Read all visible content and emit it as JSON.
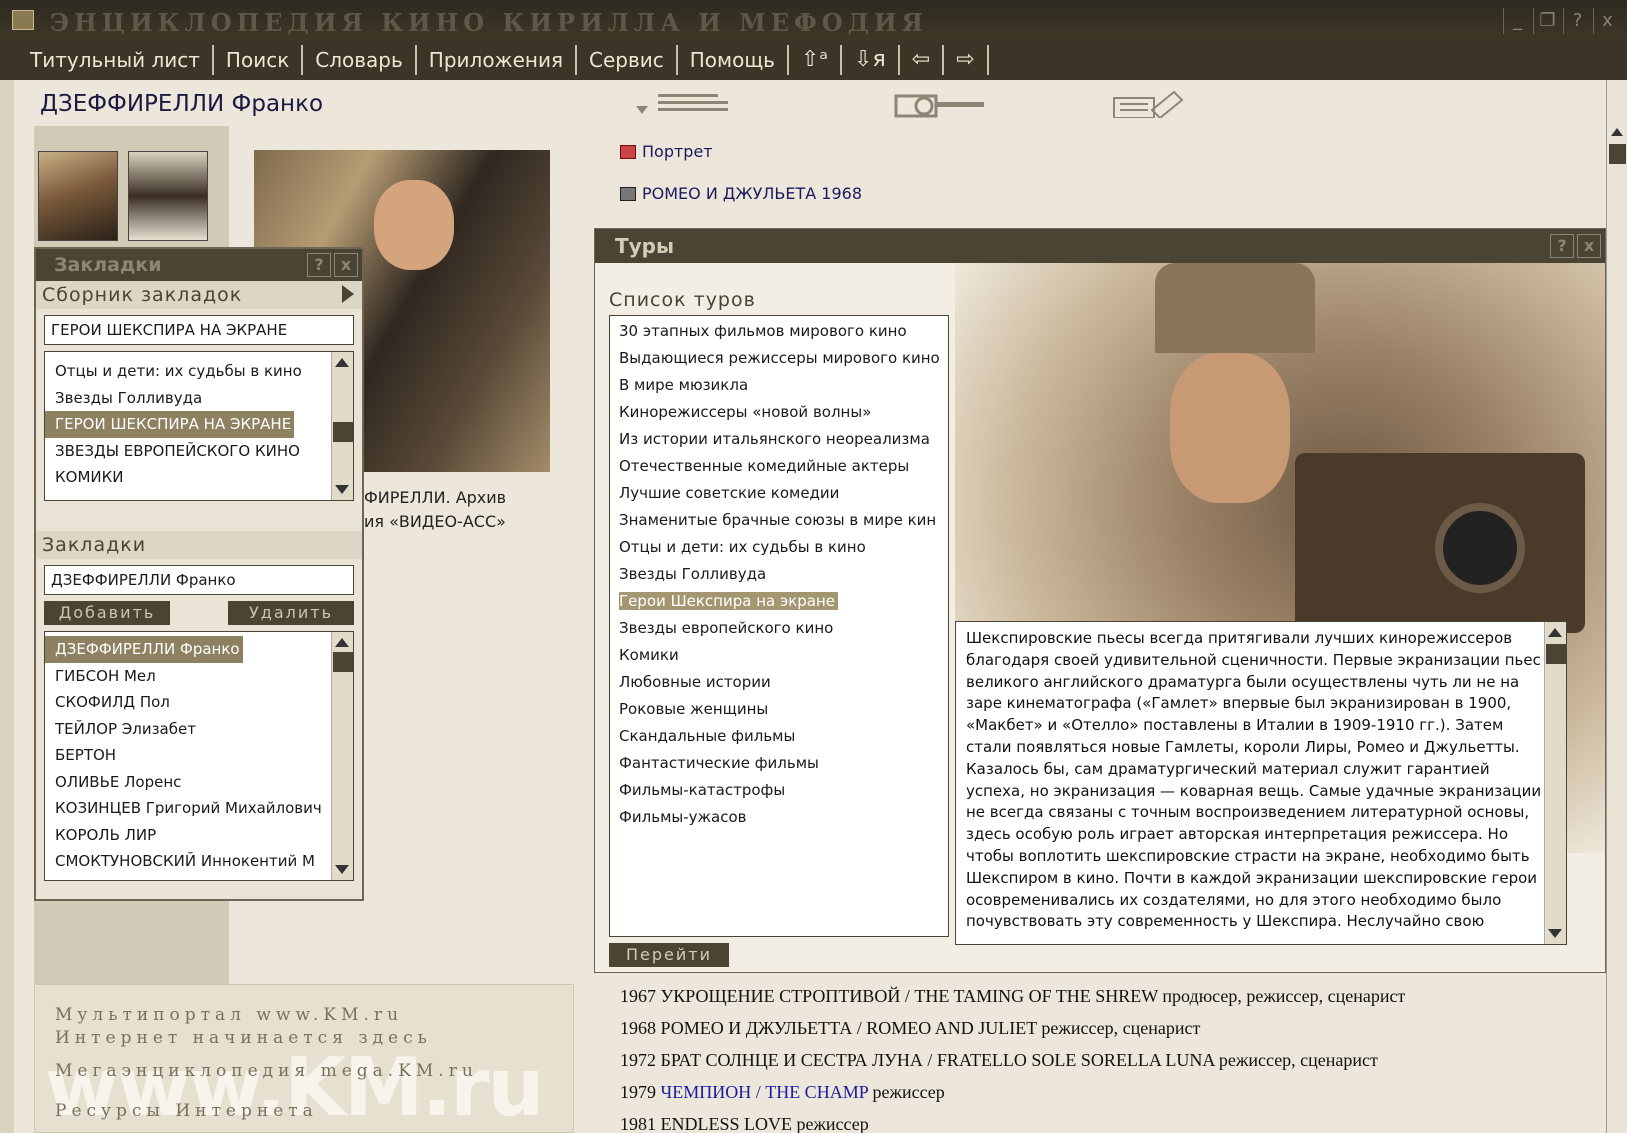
{
  "app": {
    "title": "ЭНЦИКЛОПЕДИЯ КИНО КИРИЛЛА И МЕФОДИЯ",
    "window_buttons": [
      "_",
      "❐",
      "?",
      "x"
    ]
  },
  "menu": {
    "items": [
      "Титульный лист",
      "Поиск",
      "Словарь",
      "Приложения",
      "Сервис",
      "Помощь"
    ],
    "nav_buttons": [
      "⇧ᵃ",
      "⇩я",
      "⇦",
      "⇨"
    ]
  },
  "page": {
    "title": "ДЗЕФФИРЕЛЛИ Франко"
  },
  "photo_caption": [
    "ФИРЕЛЛИ. Архив",
    "ия «ВИДЕО-АСС»"
  ],
  "bookmarks_panel": {
    "title": "Закладки",
    "collection": {
      "header": "Сборник закладок",
      "current": "ГЕРОИ ШЕКСПИРА НА ЭКРАНЕ",
      "items": [
        "Отцы и дети: их судьбы в кино",
        "Звезды Голливуда",
        "ГЕРОИ ШЕКСПИРА НА ЭКРАНЕ",
        "ЗВЕЗДЫ ЕВРОПЕЙСКОГО КИНО",
        "КОМИКИ"
      ],
      "selected_index": 2
    },
    "bookmarks": {
      "header": "Закладки",
      "current": "ДЗЕФФИРЕЛЛИ Франко",
      "add_label": "Добавить",
      "delete_label": "Удалить",
      "items": [
        "ДЗЕФФИРЕЛЛИ Франко",
        "ГИБСОН Мел",
        "СКОФИЛД Пол",
        "ТЕЙЛОР Элизабет",
        "БЕРТОН",
        "ОЛИВЬЕ Лоренс",
        "КОЗИНЦЕВ Григорий Михайлович",
        "КОРОЛЬ ЛИР",
        "СМОКТУНОВСКИЙ Иннокентий М"
      ],
      "selected_index": 0
    }
  },
  "km_ad": {
    "lines": [
      "Мультипортал www.KM.ru",
      "Интернет начинается здесь",
      "Мегаэнциклопедия mega.KM.ru",
      "Ресурсы Интернета"
    ],
    "watermark": "www.KM.ru"
  },
  "links": {
    "portrait": "Портрет",
    "film": "РОМЕО И ДЖУЛЬЕТА 1968"
  },
  "tours": {
    "title": "Туры",
    "list_label": "Список туров",
    "items": [
      "30 этапных фильмов мирового кино",
      "Выдающиеся режиссеры мирового кино",
      "В мире мюзикла",
      "Кинорежиссеры «новой волны»",
      "Из истории итальянского неореализма",
      "Отечественные комедийные актеры",
      "Лучшие советские комедии",
      "Знаменитые брачные союзы в мире кин",
      "Отцы и дети: их судьбы в кино",
      "Звезды Голливуда",
      "Герои Шекспира на экране",
      "Звезды европейского кино",
      "Комики",
      "Любовные истории",
      "Роковые женщины",
      "Скандальные фильмы",
      "Фантастические фильмы",
      "Фильмы-катастрофы",
      "Фильмы-ужасов"
    ],
    "selected_index": 10,
    "go_label": "Перейти",
    "description": "Шекспировские пьесы всегда притягивали лучших кинорежиссеров благодаря своей удивительной сценичности. Первые экранизации пьес великого английского драматурга были осуществлены чуть ли не на заре кинематографа («Гамлет» впервые был экранизирован в 1900, «Макбет» и «Отелло» поставлены в Италии в 1909-1910 гг.). Затем стали появляться новые Гамлеты, короли Лиры, Ромео и Джульетты. Казалось бы, сам драматургический материал служит гарантией успеха, но экранизация — коварная вещь. Самые удачные экранизации не всегда связаны с точным воспроизведением литературной основы, здесь особую роль играет авторская интерпретация режиссера. Но чтобы воплотить шекспировские страсти на экране, необходимо быть Шекспиром в кино. Почти в каждой экранизации шекспировские герои осовременивались их создателями, но для этого необходимо было почувствовать эту современность у Шекспира. Неслучайно свою"
  },
  "filmography": [
    {
      "pre": "1967 УКРОЩЕНИЕ СТРОПТИВОЙ / THE TAMING OF THE SHREW продюсер, режиссер, сценарист",
      "link": "",
      "post": ""
    },
    {
      "pre": "1968 РОМЕО И ДЖУЛЬЕТТА / ROMEO AND JULIET режиссер, сценарист",
      "link": "",
      "post": ""
    },
    {
      "pre": "1972 БРАТ СОЛНЦЕ И СЕСТРА ЛУНА / FRATELLO SOLE SORELLA LUNA режиссер, сценарист",
      "link": "",
      "post": ""
    },
    {
      "pre": "1979 ",
      "link": "ЧЕМПИОН / THE CHAMP",
      "post": " режиссер"
    },
    {
      "pre": "1981 ENDLESS LOVE режиссер",
      "link": "",
      "post": ""
    }
  ]
}
